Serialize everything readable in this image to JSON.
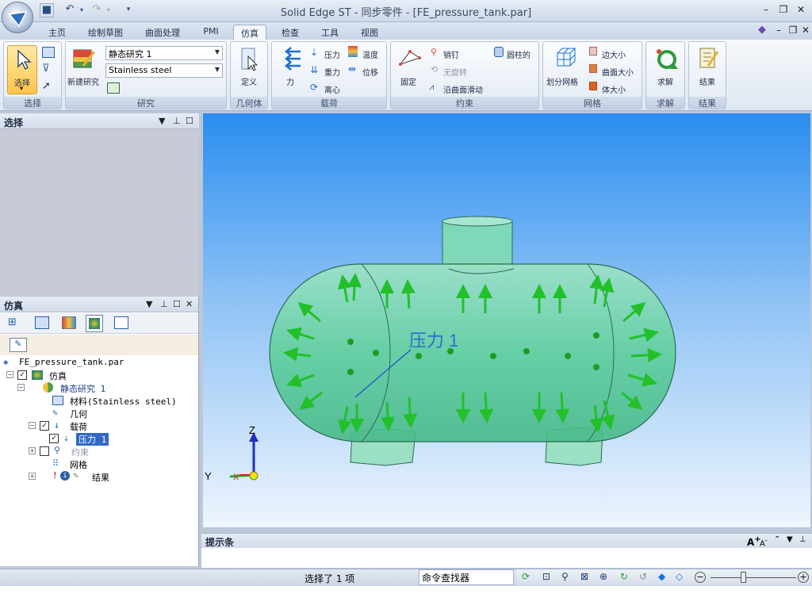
{
  "app": {
    "title": "Solid Edge ST - 同步零件 - [FE_pressure_tank.par]"
  },
  "tabs": [
    "主页",
    "绘制草图",
    "曲面处理",
    "PMI",
    "仿真",
    "检查",
    "工具",
    "视图"
  ],
  "active_tab": "仿真",
  "ribbon": {
    "select": {
      "label": "选择",
      "group": "选择"
    },
    "study": {
      "new_label": "新建研究",
      "study_value": "静态研究 1",
      "material_value": "Stainless steel",
      "group": "研究"
    },
    "geometry": {
      "define_label": "定义",
      "group": "几何体"
    },
    "loads": {
      "force": "力",
      "pressure": "压力",
      "temperature": "温度",
      "gravity": "重力",
      "displacement": "位移",
      "centrifugal": "离心",
      "group": "载荷"
    },
    "constraints": {
      "fixed": "固定",
      "pin": "销钉",
      "cylindrical": "圆柱的",
      "no_rotation": "无旋转",
      "slide": "沿曲面滑动",
      "group": "约束"
    },
    "mesh": {
      "mesh_label": "划分网格",
      "edge_size": "边大小",
      "surface_size": "曲面大小",
      "body_size": "体大小",
      "group": "网格"
    },
    "solve": {
      "label": "求解",
      "group": "求解"
    },
    "results": {
      "label": "结果",
      "group": "结果"
    }
  },
  "select_panel": {
    "title": "选择"
  },
  "sim_panel": {
    "title": "仿真",
    "tree": {
      "file": "FE_pressure_tank.par",
      "sim": "仿真",
      "study": "静态研究 1",
      "material": "材料(Stainless steel)",
      "geometry": "几何",
      "loads": "载荷",
      "load_item": "压力 1",
      "constraints": "约束",
      "mesh": "网格",
      "results": "结果"
    }
  },
  "viewport": {
    "annotation": "压力 1",
    "axis_z": "Z",
    "axis_y": "Y",
    "axis_x": "X"
  },
  "prompt": {
    "title": "提示条"
  },
  "status": {
    "selection": "选择了 1 项",
    "command_finder": "命令查找器"
  }
}
